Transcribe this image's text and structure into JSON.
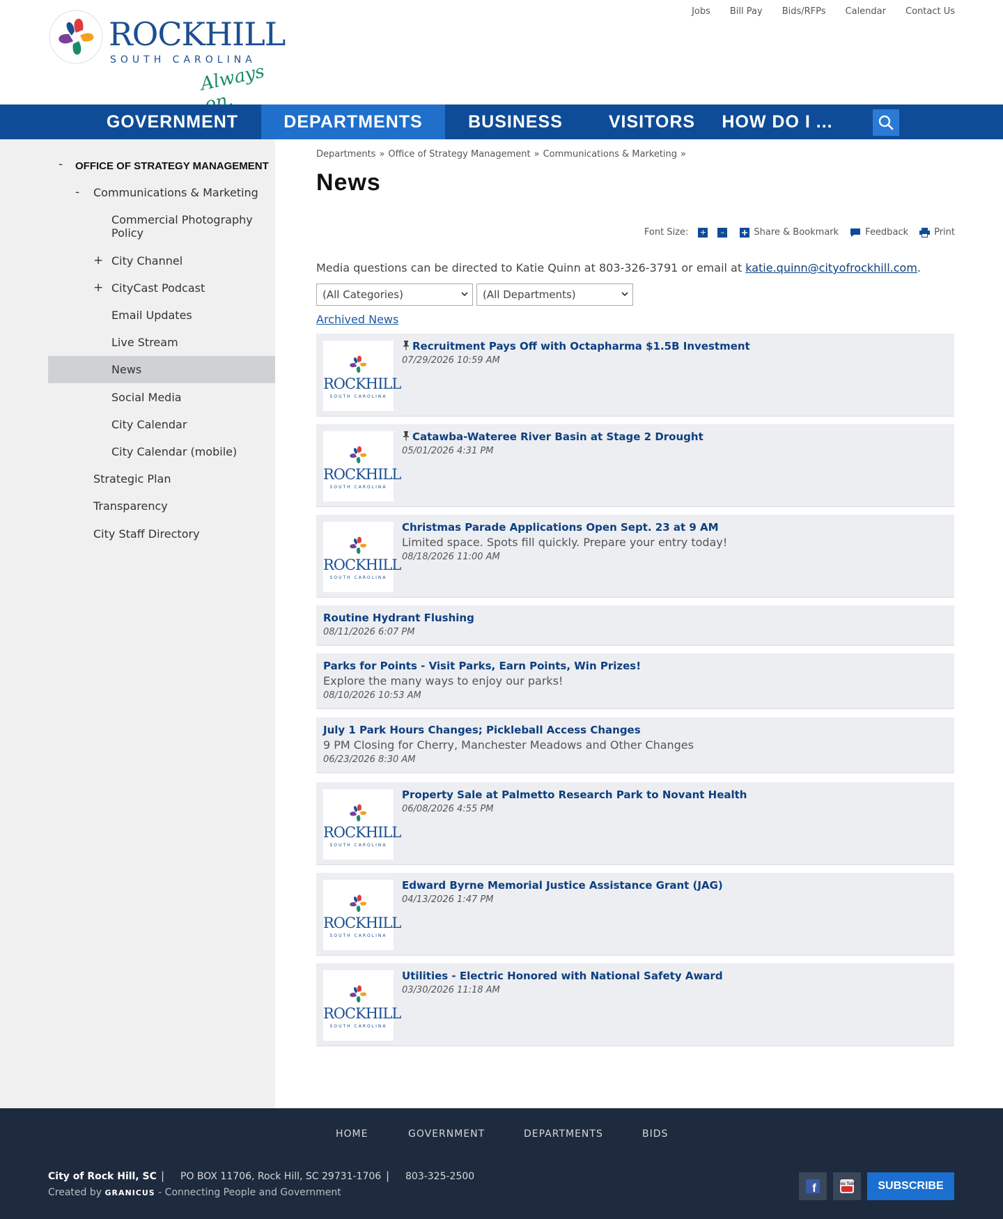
{
  "header": {
    "logo_main": "ROCKHILL",
    "logo_sub": "SOUTH CAROLINA",
    "logo_tag": "Always on.",
    "utility_links": [
      "Jobs",
      "Bill Pay",
      "Bids/RFPs",
      "Calendar",
      "Contact Us"
    ]
  },
  "nav": {
    "items": [
      "GOVERNMENT",
      "DEPARTMENTS",
      "BUSINESS",
      "VISITORS",
      "HOW DO I ..."
    ],
    "active": "DEPARTMENTS"
  },
  "sidebar": {
    "heading": "OFFICE OF STRATEGY MANAGEMENT",
    "items": [
      {
        "label": "Communications & Marketing",
        "toggle": "-"
      },
      {
        "label": "Commercial Photography Policy",
        "toggle": ""
      },
      {
        "label": "City Channel",
        "toggle": "+"
      },
      {
        "label": "CityCast Podcast",
        "toggle": "+"
      },
      {
        "label": "Email Updates",
        "toggle": ""
      },
      {
        "label": "Live Stream",
        "toggle": ""
      },
      {
        "label": "News",
        "toggle": ""
      },
      {
        "label": "Social Media",
        "toggle": ""
      },
      {
        "label": "City Calendar",
        "toggle": ""
      },
      {
        "label": "City Calendar (mobile)",
        "toggle": ""
      },
      {
        "label": "Strategic Plan",
        "toggle": ""
      },
      {
        "label": "Transparency",
        "toggle": ""
      },
      {
        "label": "City Staff Directory",
        "toggle": ""
      }
    ],
    "heading_toggle": "-"
  },
  "breadcrumb": {
    "items": [
      "Departments",
      "Office of Strategy Management",
      "Communications & Marketing"
    ],
    "separator": "»"
  },
  "page": {
    "title": "News",
    "tools": {
      "font_size_label": "Font Size:",
      "plus": "+",
      "minus": "–",
      "share": "Share & Bookmark",
      "feedback": "Feedback",
      "print": "Print"
    },
    "intro_text": "Media questions can be directed to Katie Quinn at 803-326-3791 or email at ",
    "intro_email": "katie.quinn@cityofrockhill.com",
    "intro_end": ".",
    "filter_categories": "(All Categories)",
    "filter_departments": "(All Departments)",
    "archived_link": "Archived News"
  },
  "news": [
    {
      "title": "Recruitment Pays Off with Octapharma $1.5B Investment",
      "date": "07/29/2026 10:59 AM",
      "desc": "",
      "pinned": true,
      "thumb": true
    },
    {
      "title": "Catawba-Wateree River Basin at Stage 2 Drought",
      "date": "05/01/2026 4:31 PM",
      "desc": "",
      "pinned": true,
      "thumb": true
    },
    {
      "title": "Christmas Parade Applications Open Sept. 23 at 9 AM",
      "date": "08/18/2026 11:00 AM",
      "desc": "Limited space. Spots fill quickly. Prepare your entry today!",
      "pinned": false,
      "thumb": true
    },
    {
      "title": "Routine Hydrant Flushing",
      "date": "08/11/2026 6:07 PM",
      "desc": "",
      "pinned": false,
      "thumb": false
    },
    {
      "title": "Parks for Points - Visit Parks, Earn Points, Win Prizes!",
      "date": "08/10/2026 10:53 AM",
      "desc": "Explore the many ways to enjoy our parks!",
      "pinned": false,
      "thumb": false
    },
    {
      "title": "July 1 Park Hours Changes; Pickleball Access Changes",
      "date": "06/23/2026 8:30 AM",
      "desc": "9 PM Closing for Cherry, Manchester Meadows and Other Changes",
      "pinned": false,
      "thumb": false
    },
    {
      "title": "Property Sale at Palmetto Research Park to Novant Health",
      "date": "06/08/2026 4:55 PM",
      "desc": "",
      "pinned": false,
      "thumb": true
    },
    {
      "title": "Edward Byrne Memorial Justice Assistance Grant (JAG)",
      "date": "04/13/2026 1:47 PM",
      "desc": "",
      "pinned": false,
      "thumb": true
    },
    {
      "title": "Utilities - Electric Honored with National Safety Award",
      "date": "03/30/2026 11:18 AM",
      "desc": "",
      "pinned": false,
      "thumb": true
    }
  ],
  "thumb_logo": {
    "word": "ROCKHILL",
    "sub": "SOUTH CAROLINA"
  },
  "footer": {
    "nav": [
      "HOME",
      "GOVERNMENT",
      "DEPARTMENTS",
      "BIDS"
    ],
    "city": "City of Rock Hill, SC",
    "pipe": "|",
    "address": "PO BOX 11706, Rock Hill, SC 29731-1706",
    "phone": "803-325-2500",
    "created_prefix": "Created by ",
    "created_brand": "GRANICUS",
    "created_suffix": " - Connecting People and Government",
    "subscribe": "SUBSCRIBE",
    "social_facebook": "f",
    "social_youtube": "You Tube"
  },
  "colors": {
    "brand_blue": "#0f4c97",
    "nav_active": "#1f6fcb",
    "link": "#0f3f7f",
    "footer_bg": "#1e2a3d",
    "sidebar_bg": "#f0f0f0"
  }
}
